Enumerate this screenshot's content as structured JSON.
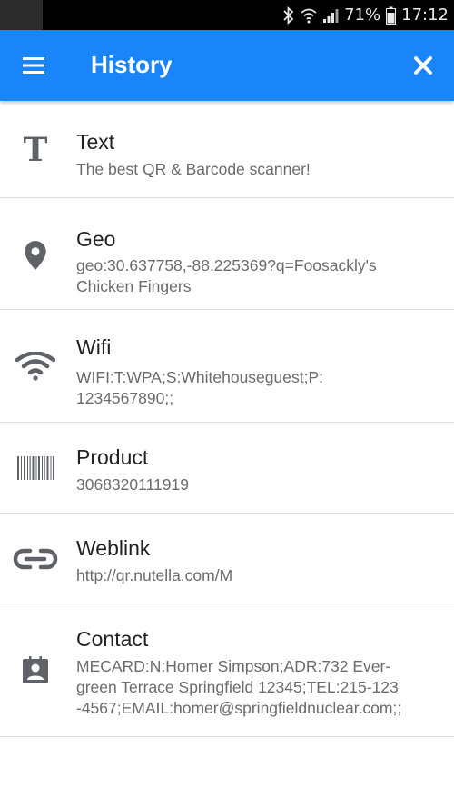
{
  "status_bar": {
    "battery": "71%",
    "time": "17:12"
  },
  "app_bar": {
    "title": "History"
  },
  "icons": {
    "menu": "hamburger-menu-icon",
    "close": "close-icon",
    "text": "text-type-icon",
    "geo": "location-pin-icon",
    "wifi": "wifi-icon",
    "product": "barcode-icon",
    "weblink": "link-icon",
    "contact": "contact-card-icon"
  },
  "colors": {
    "accent": "#1a85f9",
    "icon": "#5f6368"
  },
  "history": [
    {
      "type": "Text",
      "content": "The best QR & Barcode scanner!"
    },
    {
      "type": "Geo",
      "content_lines": [
        "geo:30.637758,-88.225369?q=Foosackly's",
        "Chicken Fingers"
      ]
    },
    {
      "type": "Wifi",
      "content_lines": [
        "WIFI:T:WPA;S:Whitehouseguest;P:",
        "1234567890;;"
      ]
    },
    {
      "type": "Product",
      "content": "3068320111919"
    },
    {
      "type": "Weblink",
      "content": "http://qr.nutella.com/M"
    },
    {
      "type": "Contact",
      "content_lines": [
        "MECARD:N:Homer Simpson;ADR:732 Ever-",
        "green Terrace Springfield 12345;TEL:215-123",
        "-4567;EMAIL:homer@springfieldnuclear.com;;"
      ]
    }
  ]
}
